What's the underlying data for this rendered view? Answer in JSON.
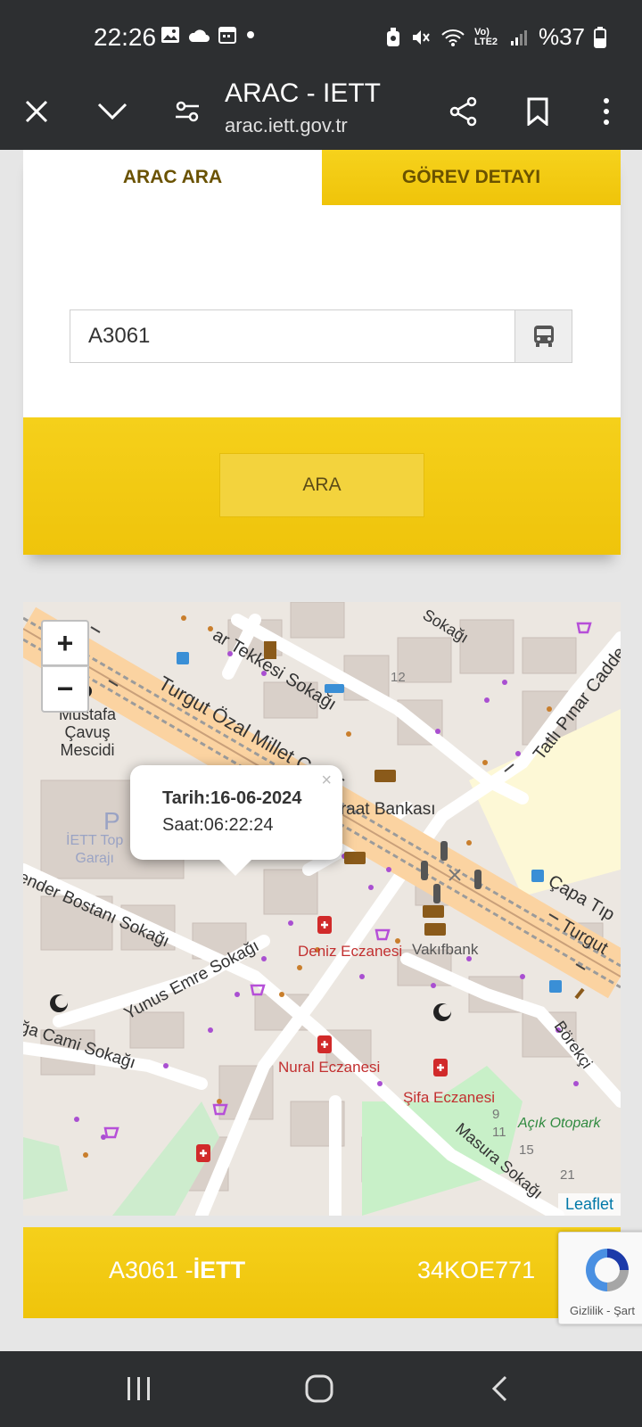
{
  "status_bar": {
    "time": "22:26",
    "battery": "%37",
    "network": "Vo) LTE2",
    "icons": [
      "image-icon",
      "cloud-icon",
      "calendar-icon",
      "dot-icon",
      "alarm-icon",
      "mute-icon",
      "wifi-icon",
      "signal-icon",
      "battery-icon"
    ]
  },
  "browser": {
    "title": "ARAC - IETT",
    "url": "arac.iett.gov.tr"
  },
  "tabs": [
    {
      "label": "ARAC ARA",
      "active": true
    },
    {
      "label": "GÖREV DETAYI",
      "active": false
    }
  ],
  "search": {
    "value": "A3061",
    "button_label": "ARA"
  },
  "map": {
    "zoom_in": "+",
    "zoom_out": "−",
    "popup_date": "Tarih:16-06-2024",
    "popup_time": "Saat:06:22:24",
    "popup_close": "×",
    "attribution": "Leaflet",
    "labels": {
      "tekkesi": "ar Tekkesi Sokağı",
      "sokagi_top": "Sokağı",
      "turgut_ozal": "Turgut Özal Millet Cadd",
      "tatli_pinar": "Tatlı Pınar Caddesi",
      "mescid": "Mustafa\nÇavuş\nMescidi",
      "ziraat": "Ziraat Bankası",
      "garaj_p": "P",
      "garaj": "İETT Top\nGarajı",
      "bostani": "ender Bostanı Sokağı",
      "capa": "Çapa Tıp",
      "turgut_right": "Turgut",
      "deniz": "Deniz Eczanesi",
      "vakifbank": "Vakıfbank",
      "yunus": "Yunus Emre Sokağı",
      "aga_cami": "ğa Cami Sokağı",
      "borekci": "Börekçi",
      "nural": "Nural Eczanesi",
      "sifa": "Şifa Eczanesi",
      "acik_otopark": "Açık Otopark",
      "masura": "Masura Sokağı",
      "n12": "12",
      "n9": "9",
      "n11": "11",
      "n15": "15",
      "n21": "21"
    }
  },
  "info_bar": {
    "vehicle_prefix": "A3061 -",
    "operator": "İETT",
    "plate": "34KOE771"
  },
  "recaptcha": {
    "text": "Gizlilik - Şart"
  },
  "colors": {
    "yellow": "#f2c811",
    "dark_bar": "#2d2f31",
    "tab_text": "#6a5200"
  }
}
